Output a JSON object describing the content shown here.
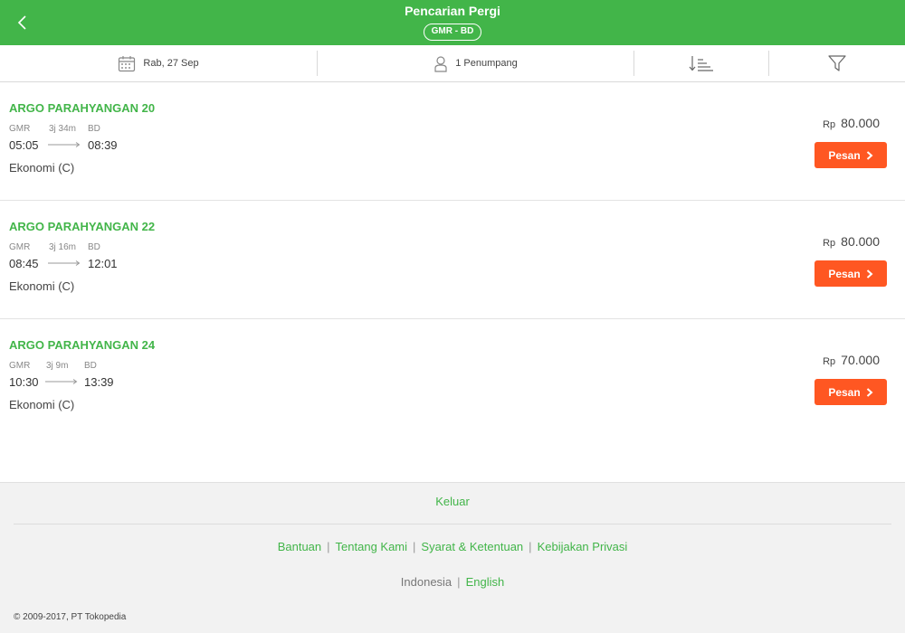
{
  "header": {
    "title": "Pencarian Pergi",
    "route": "GMR - BD"
  },
  "filter_bar": {
    "date": "Rab, 27 Sep",
    "passengers": "1 Penumpang"
  },
  "trains": [
    {
      "name": "ARGO PARAHYANGAN 20",
      "origin": "GMR",
      "destination": "BD",
      "duration": "3j 34m",
      "depart": "05:05",
      "arrive": "08:39",
      "class": "Ekonomi (C)",
      "currency": "Rp",
      "price": "80.000",
      "book_label": "Pesan"
    },
    {
      "name": "ARGO PARAHYANGAN 22",
      "origin": "GMR",
      "destination": "BD",
      "duration": "3j 16m",
      "depart": "08:45",
      "arrive": "12:01",
      "class": "Ekonomi (C)",
      "currency": "Rp",
      "price": "80.000",
      "book_label": "Pesan"
    },
    {
      "name": "ARGO PARAHYANGAN 24",
      "origin": "GMR",
      "destination": "BD",
      "duration": "3j 9m",
      "depart": "10:30",
      "arrive": "13:39",
      "class": "Ekonomi (C)",
      "currency": "Rp",
      "price": "70.000",
      "book_label": "Pesan"
    }
  ],
  "footer": {
    "logout": "Keluar",
    "links": [
      "Bantuan",
      "Tentang Kami",
      "Syarat & Ketentuan",
      "Kebijakan Privasi"
    ],
    "languages": [
      "Indonesia",
      "English"
    ],
    "copyright": "© 2009-2017, PT Tokopedia"
  },
  "colors": {
    "brand_green": "#42b549",
    "book_orange": "#ff5722"
  },
  "icons": {
    "back": "chevron-left-icon",
    "date": "calendar-icon",
    "passenger": "person-icon",
    "sort": "sort-icon",
    "filter": "filter-icon",
    "book": "chevron-right-icon",
    "route": "arrow-right-icon"
  }
}
